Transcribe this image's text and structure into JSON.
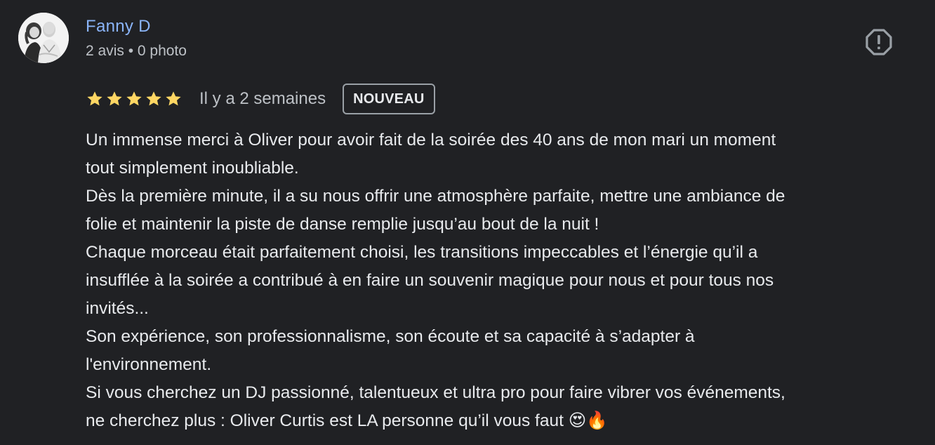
{
  "review": {
    "author": {
      "name": "Fanny D",
      "meta": "2 avis • 0 photo"
    },
    "rating": {
      "stars": 5,
      "max": 5,
      "star_color": "#fdd663"
    },
    "time": "Il y a 2 semaines",
    "badge": "NOUVEAU",
    "report_icon": "report-icon",
    "text_lines": [
      "Un immense merci à Oliver pour avoir fait de la soirée des 40 ans de mon mari un moment",
      "tout simplement inoubliable.",
      "Dès la première minute, il a su nous offrir une atmosphère parfaite, mettre une ambiance de",
      "folie et maintenir la piste de danse remplie jusqu’au bout de la nuit !",
      "Chaque morceau était parfaitement choisi, les transitions impeccables et l’énergie qu’il a",
      "insufflée à la soirée a contribué à en faire un souvenir magique pour nous et pour tous nos",
      "invités...",
      "Son expérience, son professionnalisme, son écoute et sa capacité à s’adapter à",
      "l'environnement.",
      "Si vous cherchez un DJ passionné, talentueux et ultra pro pour faire vibrer vos événements,",
      "ne cherchez plus : Oliver Curtis est LA personne qu’il vous faut 😍🔥"
    ]
  },
  "colors": {
    "background": "#202124",
    "author_link": "#8ab4f8",
    "text": "#e8eaed",
    "secondary_text": "#bdc1c6"
  }
}
